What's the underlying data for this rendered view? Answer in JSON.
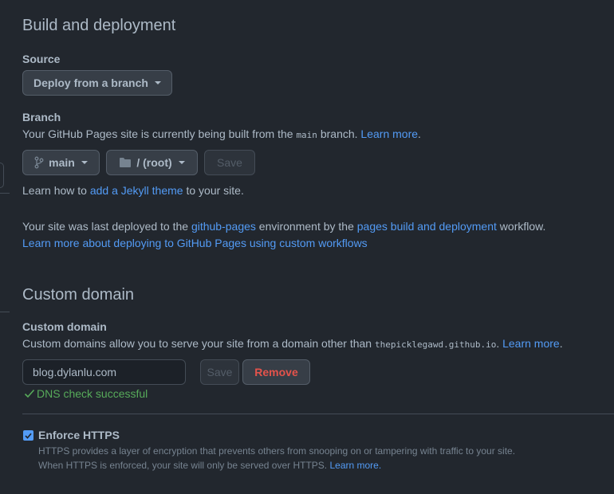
{
  "build": {
    "heading": "Build and deployment",
    "source_label": "Source",
    "source_value": "Deploy from a branch",
    "branch_label": "Branch",
    "branch_desc_prefix": "Your GitHub Pages site is currently being built from the",
    "branch_desc_code": "main",
    "branch_desc_suffix": "branch.",
    "learn_more": "Learn more",
    "branch_name": "main",
    "folder_name": "/ (root)",
    "save": "Save",
    "jekyll_prefix": "Learn how to",
    "jekyll_link": "add a Jekyll theme",
    "jekyll_suffix": "to your site.",
    "deployed_prefix": "Your site was last deployed to the",
    "deployed_env": "github-pages",
    "deployed_mid": "environment by the",
    "deployed_workflow": "pages build and deployment",
    "deployed_suffix": "workflow.",
    "custom_workflows_link": "Learn more about deploying to GitHub Pages using custom workflows"
  },
  "custom_domain": {
    "heading": "Custom domain",
    "label": "Custom domain",
    "desc_prefix": "Custom domains allow you to serve your site from a domain other than",
    "desc_code": "thepicklegawd.github.io",
    "desc_suffix": ".",
    "learn_more": "Learn more",
    "domain_value": "blog.dylanlu.com",
    "save": "Save",
    "remove": "Remove",
    "dns_status": "DNS check successful"
  },
  "https": {
    "label": "Enforce HTTPS",
    "checked": true,
    "desc_line1": "HTTPS provides a layer of encryption that prevents others from snooping on or tampering with traffic to your site.",
    "desc_line2": "When HTTPS is enforced, your site will only be served over HTTPS.",
    "learn_more": "Learn more."
  },
  "colors": {
    "background": "#22272e",
    "link": "#539bf5",
    "success": "#57ab5a",
    "danger": "#e5534b",
    "accent_checkbox": "#539bf5"
  },
  "icons": {
    "branch": "git-branch-icon",
    "folder": "folder-icon",
    "check": "check-icon"
  }
}
